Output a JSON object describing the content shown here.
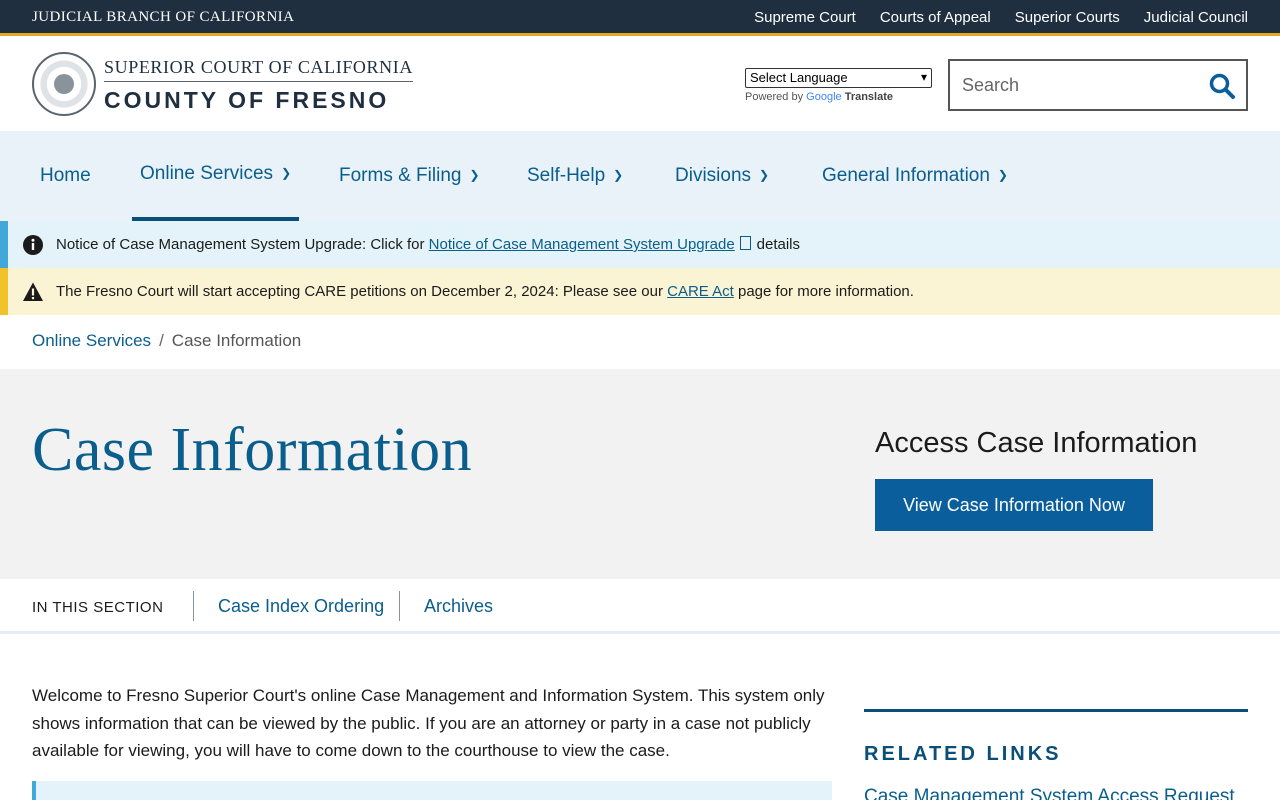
{
  "topbar": {
    "branch": "JUDICIAL BRANCH OF CALIFORNIA",
    "links": [
      "Supreme Court",
      "Courts of Appeal",
      "Superior Courts",
      "Judicial Council"
    ]
  },
  "header": {
    "logo_line1": "SUPERIOR COURT OF CALIFORNIA",
    "logo_line2": "COUNTY OF FRESNO",
    "language_select": "Select Language",
    "powered_by": "Powered by",
    "google": "Google",
    "translate": "Translate",
    "search_placeholder": "Search"
  },
  "nav": {
    "items": [
      "Home",
      "Online Services",
      "Forms & Filing",
      "Self-Help",
      "Divisions",
      "General Information"
    ],
    "active": "Online Services"
  },
  "alerts": {
    "info_prefix": "Notice of Case Management System Upgrade: Click for",
    "info_link": "Notice of Case Management System Upgrade",
    "info_suffix": "details",
    "warn_prefix": "The Fresno Court will start accepting CARE petitions on December 2, 2024: Please see our",
    "warn_link": "CARE Act",
    "warn_suffix": "page for more information."
  },
  "breadcrumb": {
    "parent": "Online Services",
    "separator": "/",
    "current": "Case Information"
  },
  "hero": {
    "title": "Case Information",
    "access_heading": "Access Case Information",
    "button": "View Case Information Now"
  },
  "section": {
    "label": "IN THIS SECTION",
    "links": [
      "Case Index Ordering",
      "Archives"
    ]
  },
  "body": {
    "intro": "Welcome to Fresno Superior Court's online Case Management and Information System. This system only shows information that can be viewed by the public. If you are an attorney or party in a case not publicly available for viewing, you will have to come down to the courthouse to view the case."
  },
  "related": {
    "title": "RELATED LINKS",
    "first_link": "Case Management System Access Request"
  },
  "colors": {
    "topbar": "#1f2f3f",
    "accent_gold": "#e4a824",
    "link_blue": "#0a5e8c",
    "button_blue": "#0a5e9c",
    "nav_bg": "#e8f2f8",
    "info_bg": "#e3f3f9",
    "warn_bg": "#faf3d4"
  }
}
